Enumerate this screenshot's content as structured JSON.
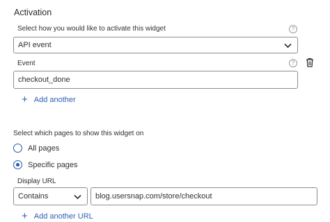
{
  "activation": {
    "title": "Activation",
    "select_label": "Select how you would like to activate this widget",
    "select_value": "API event",
    "event_label": "Event",
    "event_value": "checkout_done",
    "add_another": "Add another"
  },
  "pages": {
    "label": "Select which pages to show this widget on",
    "options": [
      "All pages",
      "Specific pages"
    ],
    "selected": "Specific pages",
    "display_url_label": "Display URL",
    "match_value": "Contains",
    "url_value": "blog.usersnap.com/store/checkout",
    "add_another_url": "Add another URL"
  },
  "colors": {
    "accent": "#2554b0",
    "link": "#2b5fb3",
    "border": "#8c8c8c"
  }
}
